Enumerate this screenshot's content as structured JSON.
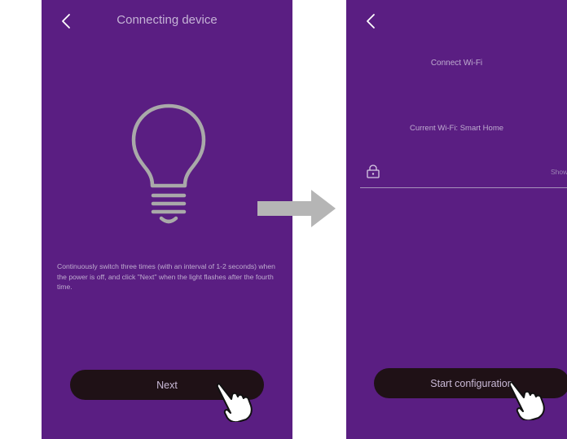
{
  "colors": {
    "screen_bg": "#5a1e82",
    "button_bg": "#1f1116",
    "text_light": "#c5b3d6",
    "arrow": "#b5b5b5"
  },
  "left_screen": {
    "back_icon": "chevron-left-icon",
    "title": "Connecting device",
    "bulb_icon": "light-bulb-icon",
    "instructions": "Continuously switch three times (with an interval of 1-2 seconds) when the power is off, and click \"Next\" when the light flashes after the fourth time.",
    "next_label": "Next",
    "hand_icon": "pointing-hand-icon"
  },
  "arrow_icon": "right-arrow-icon",
  "right_screen": {
    "back_icon": "chevron-left-icon",
    "title": "Connect Wi-Fi",
    "current_wifi": "Current Wi-Fi: Smart Home",
    "lock_icon": "lock-icon",
    "password_placeholder": "",
    "show_label": "Show",
    "start_label": "Start configuration",
    "hand_icon": "pointing-hand-icon"
  }
}
